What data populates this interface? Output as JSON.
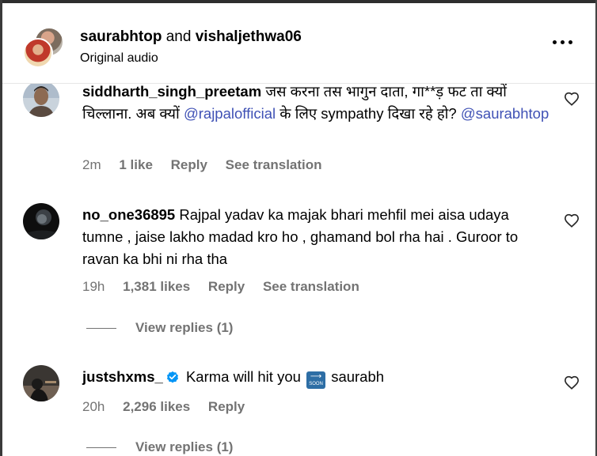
{
  "header": {
    "user1": "saurabhtop",
    "and_text": "and",
    "user2": "vishaljethwa06",
    "subtitle": "Original audio",
    "more_icon": "more-horizontal-icon"
  },
  "comments": [
    {
      "username": "siddharth_singh_preetam",
      "text_part1": "जस करना तस भागुन दाता, गा**ड़ फट ता क्यों चिल्लाना. अब क्यों",
      "mention1": "@rajpalofficial",
      "text_part2": "के लिए sympathy दिखा रहे हो?",
      "mention2": "@saurabhtop",
      "time": "2m",
      "likes": "1 like",
      "reply": "Reply",
      "translate": "See translation"
    },
    {
      "username": "no_one36895",
      "text": "Rajpal yadav ka majak bhari mehfil mei aisa udaya tumne , jaise lakho madad kro ho , ghamand bol rha hai . Guroor to ravan ka bhi ni rha tha",
      "time": "19h",
      "likes": "1,381 likes",
      "reply": "Reply",
      "translate": "See translation",
      "view_replies": "View replies (1)"
    },
    {
      "username": "justshxms_",
      "text_part1": "Karma will hit you",
      "emoji_label": "SOON",
      "text_part2": "saurabh",
      "time": "20h",
      "likes": "2,296 likes",
      "reply": "Reply",
      "view_replies": "View replies (1)"
    }
  ],
  "colors": {
    "mention": "#3f51b5",
    "meta_gray": "#737373",
    "verified_blue": "#0095f6"
  }
}
